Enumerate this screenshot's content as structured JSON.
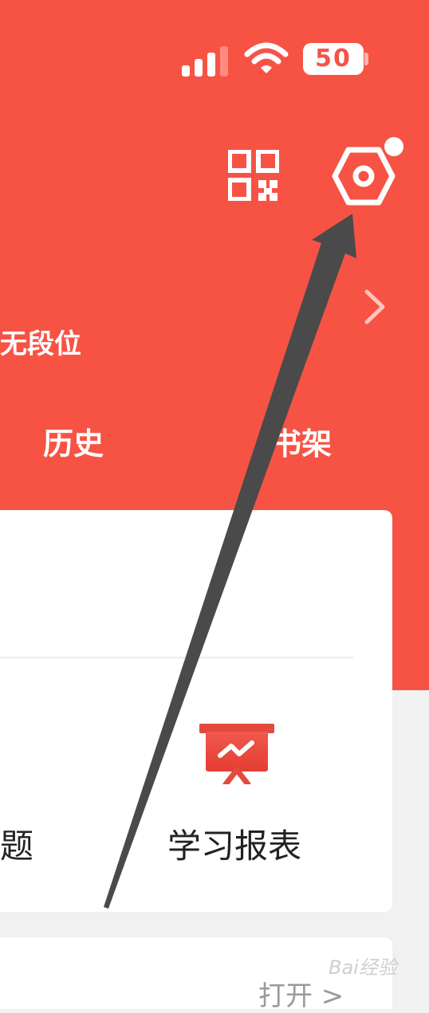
{
  "status_bar": {
    "battery_level": "50",
    "signal_icon": "cellular-signal-icon",
    "wifi_icon": "wifi-icon"
  },
  "header": {
    "qr_icon": "qr-code-icon",
    "settings_icon": "settings-hexagon-icon",
    "chevron_icon": "chevron-right-icon"
  },
  "profile": {
    "rank_text": "无段位"
  },
  "tabs": {
    "history": "历史",
    "shelf": "书架"
  },
  "quick_actions": {
    "topics_label": "题",
    "report_label": "学习报表",
    "report_icon": "report-board-icon"
  },
  "next_card": {
    "open_label": "打开 >"
  },
  "watermark": "Bai经验",
  "colors": {
    "brand_red": "#f65345",
    "card_bg": "#ffffff",
    "page_bg": "#f1f1f1",
    "annotation_arrow": "#4a4a4a"
  }
}
